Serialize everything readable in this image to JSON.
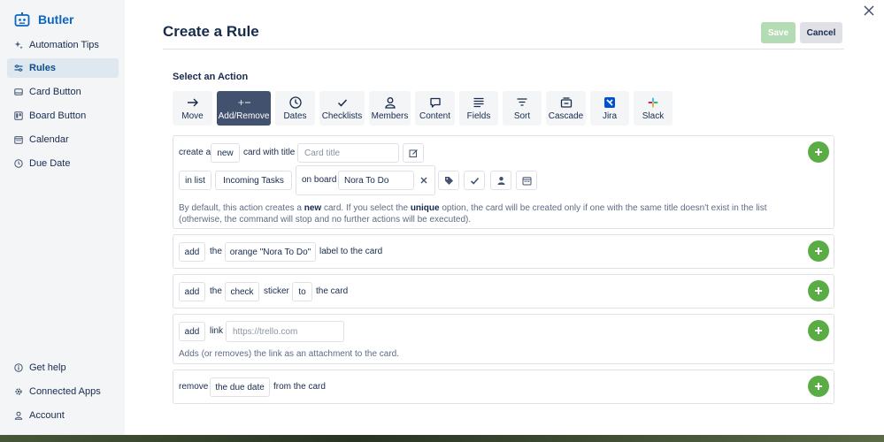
{
  "sidebar": {
    "brand": "Butler",
    "items": [
      {
        "label": "Automation Tips",
        "icon": "sparkle-icon"
      },
      {
        "label": "Rules",
        "icon": "sliders-icon",
        "active": true
      },
      {
        "label": "Card Button",
        "icon": "card-icon"
      },
      {
        "label": "Board Button",
        "icon": "board-icon"
      },
      {
        "label": "Calendar",
        "icon": "calendar-icon"
      },
      {
        "label": "Due Date",
        "icon": "clock-icon"
      }
    ],
    "bottom_items": [
      {
        "label": "Get help",
        "icon": "help-icon"
      },
      {
        "label": "Connected Apps",
        "icon": "gear-icon"
      },
      {
        "label": "Account",
        "icon": "user-icon"
      }
    ]
  },
  "header": {
    "title": "Create a Rule",
    "save_label": "Save",
    "cancel_label": "Cancel"
  },
  "actions": {
    "section_title": "Select an Action",
    "tabs": [
      {
        "label": "Move"
      },
      {
        "label": "Add/Remove",
        "active": true
      },
      {
        "label": "Dates"
      },
      {
        "label": "Checklists"
      },
      {
        "label": "Members"
      },
      {
        "label": "Content"
      },
      {
        "label": "Fields"
      },
      {
        "label": "Sort"
      },
      {
        "label": "Cascade"
      },
      {
        "label": "Jira"
      },
      {
        "label": "Slack"
      }
    ]
  },
  "rule_create_card": {
    "t1": "create a",
    "new_pill": "new",
    "t2": "card with title",
    "title_placeholder": "Card title",
    "in_list_pill": "in list",
    "list_name": "Incoming Tasks",
    "on_board_label": "on board",
    "board_value": "Nora To Do",
    "help_1": "By default, this action creates a ",
    "help_bold_1": "new",
    "help_2": " card. If you select the ",
    "help_bold_2": "unique",
    "help_3": " option, the card will be created only if one with the same title doesn't exist in the list (otherwise, the command will stop and no further actions will be executed)."
  },
  "rule_label": {
    "add_pill": "add",
    "t1": "the",
    "label_pill": "orange \"Nora To Do\"",
    "t2": "label to the card"
  },
  "rule_sticker": {
    "add_pill": "add",
    "t1": "the",
    "sticker_pill": "check",
    "t2": "sticker",
    "to_pill": "to",
    "t3": "the card"
  },
  "rule_link": {
    "add_pill": "add",
    "t1": "link",
    "url_placeholder": "https://trello.com",
    "help": "Adds (or removes) the link as an attachment to the card."
  },
  "rule_due": {
    "remove": "remove",
    "due_pill": "the due date",
    "t1": "from the card"
  },
  "colors": {
    "brand_blue": "#0b66c3",
    "active_tab": "#42526e",
    "plus_green": "#5aac44",
    "save_disabled": "#b3dbb4"
  }
}
